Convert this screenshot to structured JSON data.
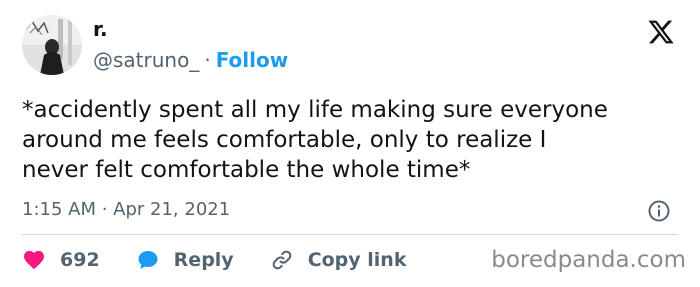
{
  "author": {
    "display_name": "r.",
    "handle": "@satruno_",
    "separator": "·",
    "follow_label": "Follow"
  },
  "tweet": {
    "text": "*accidently spent all my life making sure everyone\naround me feels comfortable, only to realize I\nnever felt comfortable the whole time*",
    "timestamp": "1:15 AM · Apr 21, 2021"
  },
  "actions": {
    "likes_count": "692",
    "reply_label": "Reply",
    "copy_link_label": "Copy link"
  },
  "watermark": "boredpanda.com",
  "colors": {
    "text": "#0f1419",
    "secondary": "#536471",
    "accent": "#1d9bf0",
    "like": "#f91880",
    "divider": "#cfd9de"
  },
  "icons": {
    "logo": "x-logo-icon",
    "info": "info-icon",
    "like": "heart-icon",
    "reply": "speech-bubble-icon",
    "copy_link": "link-icon"
  }
}
